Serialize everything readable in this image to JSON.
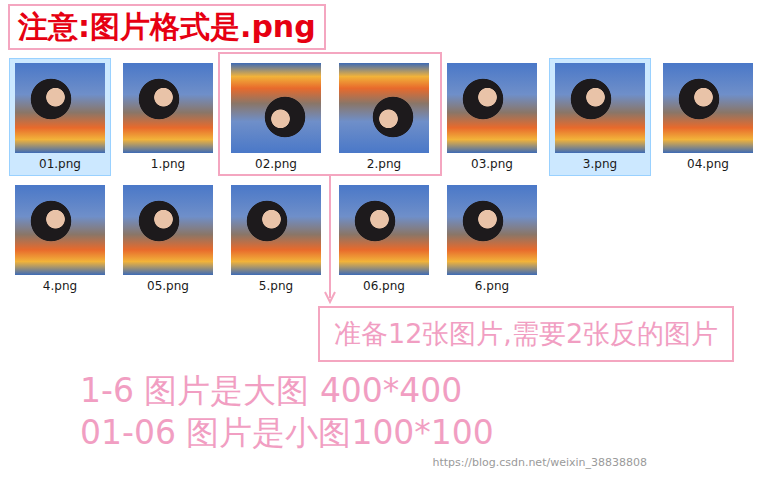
{
  "notice": "注意:图片格式是.png",
  "files": [
    {
      "name": "01.png",
      "selected": true,
      "flipped": false,
      "grouped": false
    },
    {
      "name": "1.png",
      "selected": false,
      "flipped": false,
      "grouped": false
    },
    {
      "name": "02.png",
      "selected": false,
      "flipped": true,
      "grouped": true
    },
    {
      "name": "2.png",
      "selected": false,
      "flipped": true,
      "grouped": true
    },
    {
      "name": "03.png",
      "selected": false,
      "flipped": false,
      "grouped": false
    },
    {
      "name": "3.png",
      "selected": true,
      "flipped": false,
      "grouped": false
    },
    {
      "name": "04.png",
      "selected": false,
      "flipped": false,
      "grouped": false
    },
    {
      "name": "4.png",
      "selected": false,
      "flipped": false,
      "grouped": false
    },
    {
      "name": "05.png",
      "selected": false,
      "flipped": false,
      "grouped": false
    },
    {
      "name": "5.png",
      "selected": false,
      "flipped": false,
      "grouped": false
    },
    {
      "name": "06.png",
      "selected": false,
      "flipped": false,
      "grouped": false
    },
    {
      "name": "6.png",
      "selected": false,
      "flipped": false,
      "grouped": false
    }
  ],
  "group_caption": "准备12张图片,需要2张反的图片",
  "notes": [
    "1-6 图片是大图 400*400",
    "01-06 图片是小图100*100"
  ],
  "watermark": "https://blog.csdn.net/weixin_38838808"
}
